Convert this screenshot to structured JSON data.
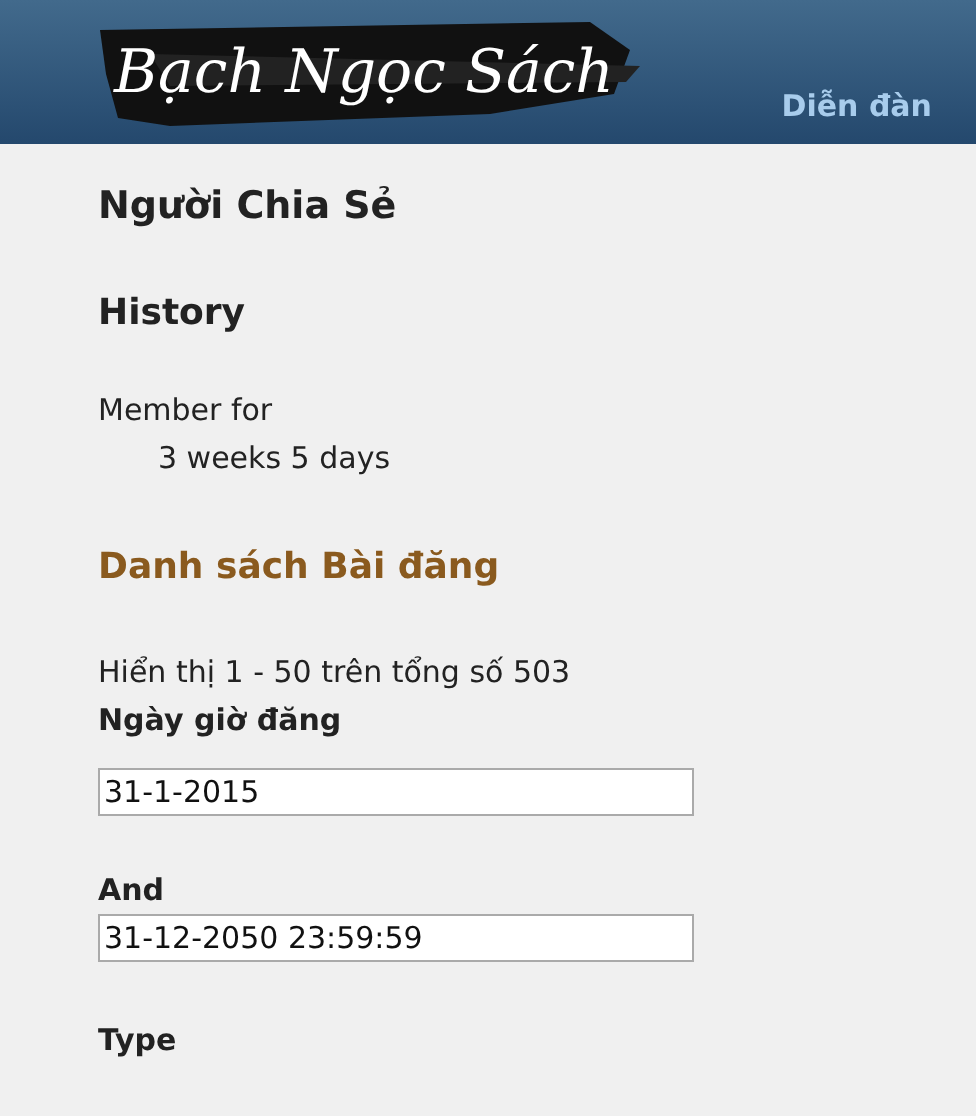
{
  "header": {
    "logo": "Bạch Ngọc Sách",
    "nav_link": "Diễn đàn"
  },
  "profile_title": "Người Chia Sẻ",
  "history": {
    "heading": "History",
    "label": "Member for",
    "value": "3 weeks 5 days"
  },
  "posts": {
    "heading": "Danh sách Bài đăng",
    "summary": "Hiển thị 1 - 50 trên tổng số 503",
    "filters": [
      {
        "label": "Ngày giờ đăng",
        "value": "31-1-2015"
      },
      {
        "label": "And",
        "value": "31-12-2050 23:59:59"
      }
    ],
    "type_label": "Type"
  }
}
